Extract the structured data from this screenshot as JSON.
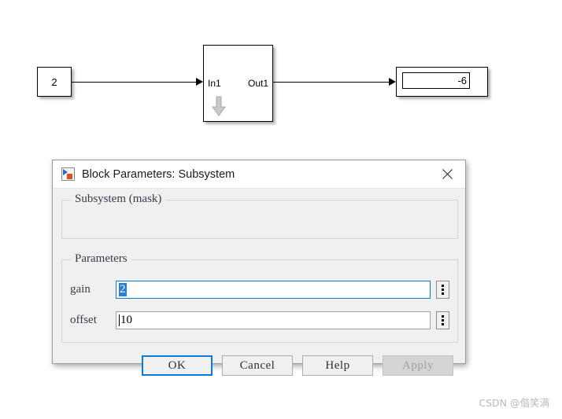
{
  "diagram": {
    "constant_block": {
      "value": "2"
    },
    "subsystem_block": {
      "in_port": "In1",
      "out_port": "Out1"
    },
    "display_block": {
      "value": "-6"
    }
  },
  "dialog": {
    "title": "Block Parameters: Subsystem",
    "title_icon": "simulink-block-icon",
    "close_icon": "close-icon",
    "mask_group_legend": "Subsystem (mask)",
    "parameters_group_legend": "Parameters",
    "fields": [
      {
        "label": "gain",
        "value": "2",
        "selected": true,
        "focused": true,
        "stepper_icon": "vertical-dots-icon"
      },
      {
        "label": "offset",
        "value": "10",
        "selected": false,
        "focused": false,
        "stepper_icon": "vertical-dots-icon"
      }
    ],
    "buttons": [
      {
        "label": "OK",
        "state": "default"
      },
      {
        "label": "Cancel",
        "state": "normal"
      },
      {
        "label": "Help",
        "state": "normal"
      },
      {
        "label": "Apply",
        "state": "disabled"
      }
    ]
  },
  "watermark": {
    "text": "CSDN @偕笑满"
  },
  "colors": {
    "accent_blue": "#0b7cd4",
    "selection_blue": "#2a7fd4",
    "dialog_bg": "#f0f0f0",
    "titlebar_bg": "#ffffff",
    "disabled_bg": "#d4d4d4",
    "watermark_gray": "#b9b9b9"
  }
}
